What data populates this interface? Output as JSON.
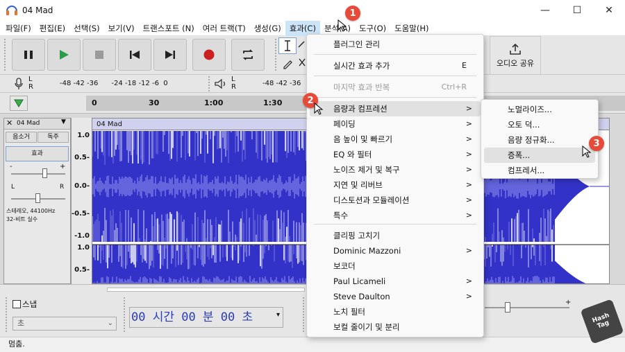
{
  "window": {
    "title": "04 Mad",
    "controls": {
      "minimize": "—",
      "maximize": "☐",
      "close": "✕"
    }
  },
  "menubar": [
    "파일(F)",
    "편집(E)",
    "선택(S)",
    "보기(V)",
    "트랜스포트 (N)",
    "여러 트랙(T)",
    "생성(G)",
    "효과(C)",
    "분석(A)",
    "도구(O)",
    "도움말(H)"
  ],
  "toolbar": {
    "share_label": "오디오 공유"
  },
  "meters": {
    "rec_scale": "-48 -42 -36      -24 -18 -12 -6  0",
    "play_scale": "-48 -42 -36      -24 -18 -12 -6  0",
    "L": "L",
    "R": "R"
  },
  "timeline": {
    "ticks": [
      {
        "label": "0"
      },
      {
        "label": "30"
      },
      {
        "label": "1:00"
      },
      {
        "label": "1:30"
      }
    ]
  },
  "track": {
    "name": "04 Mad",
    "mute": "음소거",
    "solo": "독주",
    "effects": "효과",
    "info_line1": "스테레오, 44100Hz",
    "info_line2": "32-비트 실수",
    "clip_name": "04 Mad",
    "pan_L": "L",
    "pan_R": "R",
    "gain_minus": "-",
    "gain_plus": "+"
  },
  "yaxis": [
    "1.0",
    "0.5-",
    "0.0-",
    "-0.5-",
    "-1.0",
    "1.0",
    "0.5-"
  ],
  "bottom": {
    "snap_label": "스냅",
    "snap_unit": "초",
    "time_display": "00 시간 00 분 00 초",
    "plus": "+"
  },
  "status": "멈춤.",
  "effects_menu": {
    "items": [
      {
        "label": "플러그인 관리",
        "shortcut": "",
        "arrow": "",
        "disabled": false
      },
      {
        "label": "실시간 효과 추가",
        "shortcut": "E",
        "arrow": "",
        "disabled": false
      },
      {
        "label": "마지막 효과 반복",
        "shortcut": "Ctrl+R",
        "arrow": "",
        "disabled": true
      },
      {
        "label": "음량과 컴프레션",
        "shortcut": "",
        "arrow": ">",
        "disabled": false
      },
      {
        "label": "페이딩",
        "shortcut": "",
        "arrow": ">",
        "disabled": false
      },
      {
        "label": "음 높이 및 빠르기",
        "shortcut": "",
        "arrow": ">",
        "disabled": false
      },
      {
        "label": "EQ 와 필터",
        "shortcut": "",
        "arrow": ">",
        "disabled": false
      },
      {
        "label": "노이즈 제거 및 복구",
        "shortcut": "",
        "arrow": ">",
        "disabled": false
      },
      {
        "label": "지연 및 리버브",
        "shortcut": "",
        "arrow": ">",
        "disabled": false
      },
      {
        "label": "디스토션과 모듈레이션",
        "shortcut": "",
        "arrow": ">",
        "disabled": false
      },
      {
        "label": "특수",
        "shortcut": "",
        "arrow": ">",
        "disabled": false
      },
      {
        "label": "클리핑 고치기",
        "shortcut": "",
        "arrow": "",
        "disabled": false
      },
      {
        "label": "Dominic Mazzoni",
        "shortcut": "",
        "arrow": ">",
        "disabled": false
      },
      {
        "label": "보코더",
        "shortcut": "",
        "arrow": "",
        "disabled": false
      },
      {
        "label": "Paul Licameli",
        "shortcut": "",
        "arrow": ">",
        "disabled": false
      },
      {
        "label": "Steve Daulton",
        "shortcut": "",
        "arrow": ">",
        "disabled": false
      },
      {
        "label": "노치 필터",
        "shortcut": "",
        "arrow": "",
        "disabled": false
      },
      {
        "label": "보컬 줄이기 및 분리",
        "shortcut": "",
        "arrow": "",
        "disabled": false
      }
    ]
  },
  "submenu": {
    "items": [
      "노멀라이즈...",
      "오토 덕...",
      "음량 정규화...",
      "증폭...",
      "컴프레서..."
    ]
  },
  "badges": [
    "1",
    "2",
    "3"
  ],
  "watermark": "Hash Tag",
  "colors": {
    "waveform": "#3232c8",
    "waveform_light": "#6464dc",
    "badge": "#e84a3a",
    "record": "#cc2020",
    "play": "#2a9d4a"
  }
}
